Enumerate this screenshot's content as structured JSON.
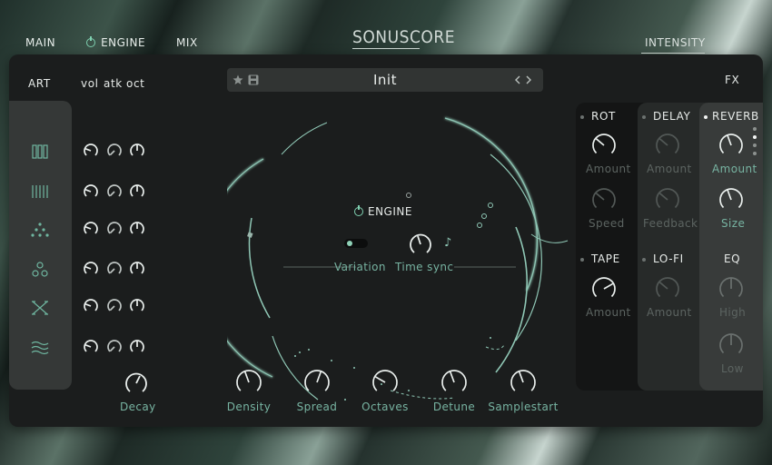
{
  "nav": {
    "main": "MAIN",
    "engine": "ENGINE",
    "mix": "MIX",
    "intensity": "INTENSITY"
  },
  "logo": "SONUSCORE",
  "left": {
    "art": "ART",
    "vol": "vol",
    "atk": "atk",
    "oct": "oct",
    "art_icons": [
      "bars-thick-icon",
      "bars-thin-icon",
      "dots-triangle-icon",
      "circles-icon",
      "cross-icon",
      "waves-icon"
    ]
  },
  "preset": {
    "name": "Init"
  },
  "engine": {
    "title": "ENGINE",
    "variation": "Variation",
    "time_sync": "Time sync"
  },
  "knobs": {
    "decay": "Decay",
    "density": "Density",
    "spread": "Spread",
    "octaves": "Octaves",
    "detune": "Detune",
    "samplestart": "Samplestart"
  },
  "fx": {
    "title": "FX",
    "rot": {
      "label": "ROT",
      "amount": "Amount",
      "speed": "Speed"
    },
    "delay": {
      "label": "DELAY",
      "amount": "Amount",
      "feedback": "Feedback"
    },
    "reverb": {
      "label": "REVERB",
      "amount": "Amount",
      "size": "Size"
    },
    "tape": {
      "label": "TAPE",
      "amount": "Amount"
    },
    "lofi": {
      "label": "LO-FI",
      "amount": "Amount"
    },
    "eq": {
      "label": "EQ",
      "high": "High",
      "low": "Low"
    }
  },
  "colors": {
    "accent": "#77b3a1",
    "panel": "#1b1d1d"
  }
}
